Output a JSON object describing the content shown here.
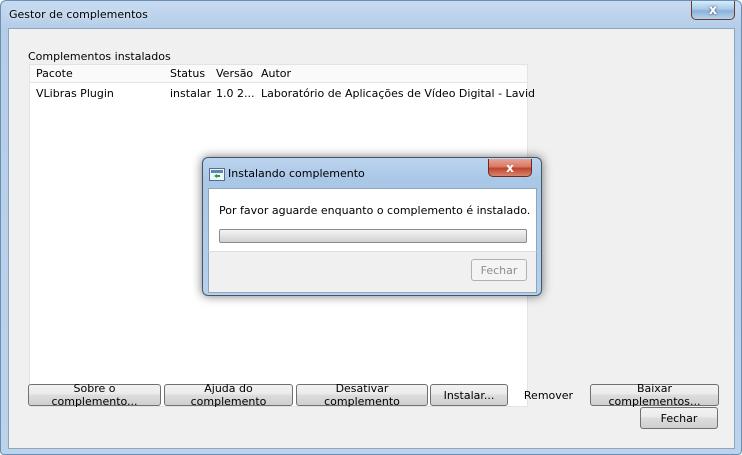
{
  "window": {
    "title": "Gestor de complementos",
    "close_glyph": "x"
  },
  "installed": {
    "section_label": "Complementos instalados",
    "columns": [
      "Pacote",
      "Status",
      "Versão",
      "Autor"
    ],
    "rows": [
      {
        "package": "VLibras Plugin",
        "status": "instalar",
        "version": "1.0 2...",
        "author": "Laboratório de Aplicações de Vídeo Digital - Lavid"
      }
    ]
  },
  "buttons": {
    "about": "Sobre o complemento...",
    "help": "Ajuda do complemento",
    "disable": "Desativar complemento",
    "install": "Instalar...",
    "remove": "Remover",
    "download": "Baixar complementos...",
    "close": "Fechar"
  },
  "dialog": {
    "title": "Instalando complemento",
    "close_glyph": "x",
    "message": "Por favor aguarde enquanto o complemento é instalado.",
    "progress": 0,
    "close_label": "Fechar",
    "icon": "install-app-icon"
  },
  "colors": {
    "frame": "#b4cde9",
    "dialog_close": "#c0432b"
  }
}
